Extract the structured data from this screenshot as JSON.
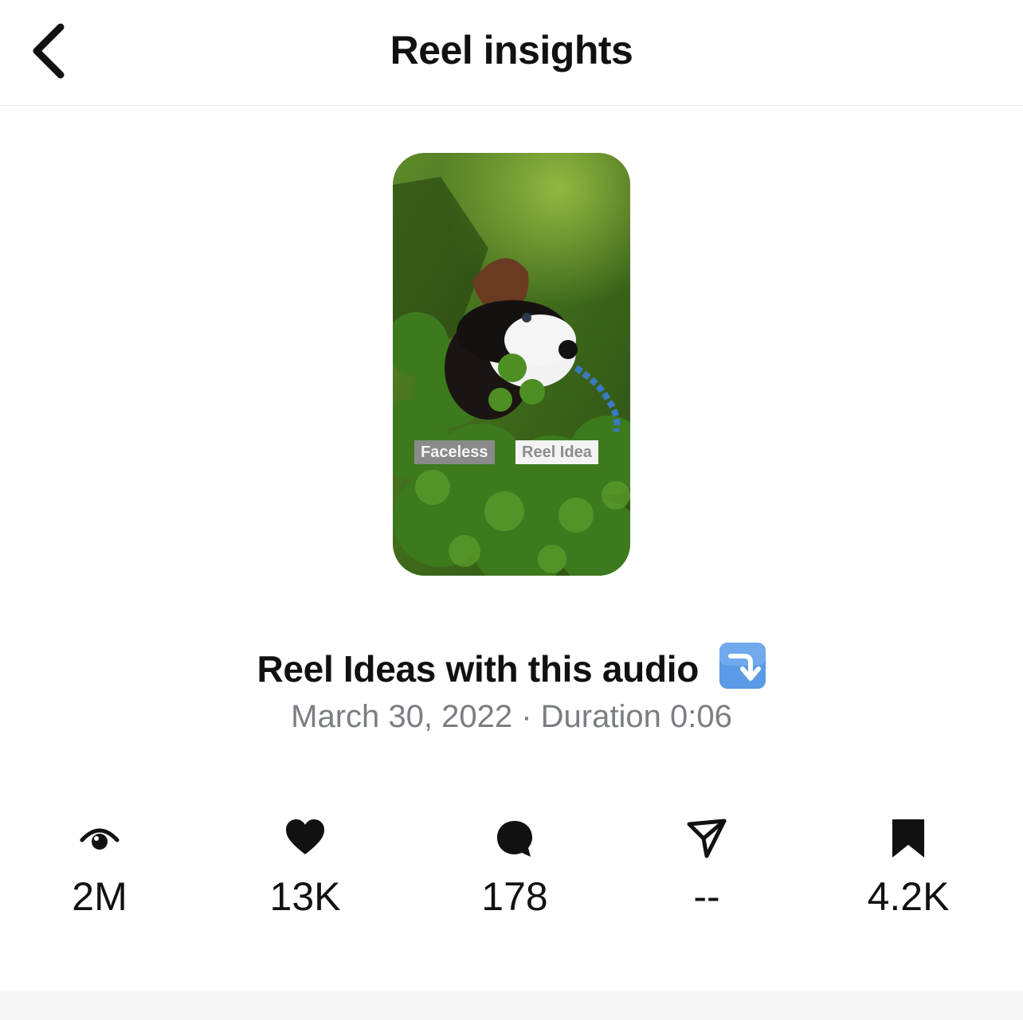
{
  "header": {
    "title": "Reel insights",
    "back_icon": "chevron-left-icon"
  },
  "reel": {
    "tags": [
      "Faceless",
      "Reel Idea"
    ],
    "caption": "Reel Ideas with this audio",
    "caption_emoji": "arrow-down-right-emoji",
    "date": "March 30, 2022",
    "separator": "·",
    "duration_label": "Duration",
    "duration": "0:06"
  },
  "stats": [
    {
      "icon": "eye-icon",
      "value": "2M"
    },
    {
      "icon": "heart-icon",
      "value": "13K"
    },
    {
      "icon": "comment-icon",
      "value": "178"
    },
    {
      "icon": "send-icon",
      "value": "--"
    },
    {
      "icon": "bookmark-icon",
      "value": "4.2K"
    }
  ],
  "colors": {
    "text_primary": "#111111",
    "text_secondary": "#7a7d82",
    "emoji_blue": "#4a90e2"
  }
}
